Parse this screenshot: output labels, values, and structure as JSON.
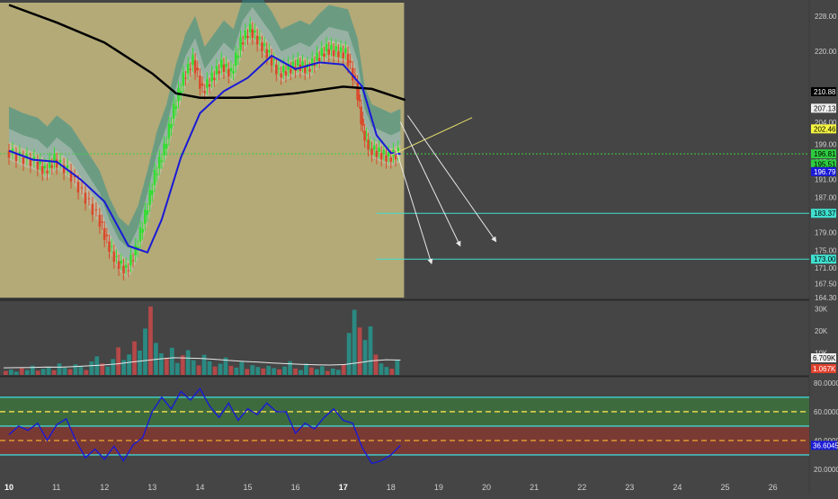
{
  "chart_data": [
    {
      "type": "candlestick",
      "panel": "price",
      "title": "",
      "ylim": [
        164.3,
        231
      ],
      "yticks": [
        164.3,
        167.5,
        171.0,
        175.0,
        179.0,
        183.0,
        187.0,
        191.0,
        195.0,
        199.0,
        204.0,
        210.88,
        220.0,
        228.0
      ],
      "ytick_labels": [
        "164.30",
        "167.50",
        "171.00",
        "175.00",
        "179.00",
        "183.00",
        "187.00",
        "191.00",
        "195.00",
        "199.00",
        "204.00",
        "210.88",
        "220.00",
        "228.00"
      ],
      "price_labels": [
        {
          "value": 210.88,
          "text": "210.88",
          "bg": "#000000",
          "fg": "#ffffff"
        },
        {
          "value": 207.13,
          "text": "207.13",
          "bg": "#f0f0f0",
          "fg": "#000000"
        },
        {
          "value": 202.46,
          "text": "202.46",
          "bg": "#f5f542",
          "fg": "#000000"
        },
        {
          "value": 196.81,
          "text": "196.81",
          "bg": "#2ecc40",
          "fg": "#000000"
        },
        {
          "value": 194.51,
          "text": "195.51",
          "bg": "#2ecc40",
          "fg": "#000000"
        },
        {
          "value": 192.79,
          "text": "196.79",
          "bg": "#1a1ad6",
          "fg": "#ffffff"
        },
        {
          "value": 183.37,
          "text": "183.37",
          "bg": "#40e0d0",
          "fg": "#000000"
        },
        {
          "value": 173.0,
          "text": "173.00",
          "bg": "#40e0d0",
          "fg": "#000000"
        }
      ],
      "current_price_line": 196.81,
      "horizontal_levels": [
        183.37,
        173.0
      ],
      "x_labels": [
        "10",
        "11",
        "12",
        "13",
        "14",
        "15",
        "16",
        "17",
        "18",
        "19",
        "20",
        "21",
        "22",
        "23",
        "24",
        "25",
        "26"
      ],
      "bold_x_labels": [
        "10",
        "17"
      ],
      "close_series": [
        {
          "t": 0.0,
          "v": 197.5
        },
        {
          "t": 0.3,
          "v": 196.0
        },
        {
          "t": 0.6,
          "v": 195.0
        },
        {
          "t": 0.8,
          "v": 193.0
        },
        {
          "t": 1.0,
          "v": 195.5
        },
        {
          "t": 1.3,
          "v": 193.0
        },
        {
          "t": 1.6,
          "v": 188.0
        },
        {
          "t": 1.9,
          "v": 183.0
        },
        {
          "t": 2.1,
          "v": 177.0
        },
        {
          "t": 2.3,
          "v": 172.5
        },
        {
          "t": 2.5,
          "v": 170.5
        },
        {
          "t": 2.7,
          "v": 175.0
        },
        {
          "t": 2.9,
          "v": 183.0
        },
        {
          "t": 3.1,
          "v": 192.0
        },
        {
          "t": 3.3,
          "v": 198.0
        },
        {
          "t": 3.5,
          "v": 207.0
        },
        {
          "t": 3.7,
          "v": 214.0
        },
        {
          "t": 3.9,
          "v": 218.0
        },
        {
          "t": 4.1,
          "v": 211.0
        },
        {
          "t": 4.3,
          "v": 214.0
        },
        {
          "t": 4.5,
          "v": 217.0
        },
        {
          "t": 4.7,
          "v": 215.0
        },
        {
          "t": 4.9,
          "v": 222.0
        },
        {
          "t": 5.1,
          "v": 225.0
        },
        {
          "t": 5.3,
          "v": 222.0
        },
        {
          "t": 5.5,
          "v": 219.0
        },
        {
          "t": 5.7,
          "v": 215.0
        },
        {
          "t": 5.9,
          "v": 216.0
        },
        {
          "t": 6.1,
          "v": 217.0
        },
        {
          "t": 6.3,
          "v": 216.0
        },
        {
          "t": 6.5,
          "v": 218.5
        },
        {
          "t": 6.7,
          "v": 220.5
        },
        {
          "t": 6.9,
          "v": 220.0
        },
        {
          "t": 7.1,
          "v": 219.5
        },
        {
          "t": 7.3,
          "v": 213.0
        },
        {
          "t": 7.45,
          "v": 202.0
        },
        {
          "t": 7.6,
          "v": 198.0
        },
        {
          "t": 7.8,
          "v": 197.0
        },
        {
          "t": 8.0,
          "v": 196.0
        },
        {
          "t": 8.2,
          "v": 197.0
        }
      ],
      "series": [
        {
          "name": "",
          "role": "ma200",
          "color": "#000000",
          "values": [
            {
              "t": 0.0,
              "v": 230.5
            },
            {
              "t": 1.0,
              "v": 226.5
            },
            {
              "t": 2.0,
              "v": 222.0
            },
            {
              "t": 3.0,
              "v": 215.0
            },
            {
              "t": 3.5,
              "v": 210.5
            },
            {
              "t": 4.0,
              "v": 209.5
            },
            {
              "t": 5.0,
              "v": 209.5
            },
            {
              "t": 6.0,
              "v": 210.5
            },
            {
              "t": 7.0,
              "v": 212.0
            },
            {
              "t": 7.6,
              "v": 211.5
            },
            {
              "t": 8.3,
              "v": 209.0
            }
          ]
        },
        {
          "name": "",
          "role": "ema-fast",
          "color": "#1a1ad6",
          "values": [
            {
              "t": 0.0,
              "v": 197.5
            },
            {
              "t": 0.5,
              "v": 195.5
            },
            {
              "t": 1.0,
              "v": 195.0
            },
            {
              "t": 1.5,
              "v": 191.0
            },
            {
              "t": 2.0,
              "v": 186.0
            },
            {
              "t": 2.5,
              "v": 176.0
            },
            {
              "t": 2.9,
              "v": 174.5
            },
            {
              "t": 3.2,
              "v": 182.0
            },
            {
              "t": 3.6,
              "v": 196.0
            },
            {
              "t": 4.0,
              "v": 206.0
            },
            {
              "t": 4.5,
              "v": 211.0
            },
            {
              "t": 5.0,
              "v": 214.0
            },
            {
              "t": 5.5,
              "v": 219.0
            },
            {
              "t": 6.0,
              "v": 216.0
            },
            {
              "t": 6.5,
              "v": 217.5
            },
            {
              "t": 7.0,
              "v": 217.0
            },
            {
              "t": 7.4,
              "v": 212.0
            },
            {
              "t": 7.7,
              "v": 201.0
            },
            {
              "t": 8.0,
              "v": 197.0
            },
            {
              "t": 8.2,
              "v": 196.8
            }
          ]
        }
      ],
      "projection_arrows": [
        {
          "from_t": 8.1,
          "from_v": 198.0,
          "to_t": 8.85,
          "to_v": 172.0
        },
        {
          "from_t": 8.2,
          "from_v": 204.0,
          "to_t": 9.45,
          "to_v": 176.0
        },
        {
          "from_t": 8.35,
          "from_v": 205.5,
          "to_t": 10.2,
          "to_v": 177.0
        }
      ],
      "trendline": {
        "from_t": 8.0,
        "from_v": 196.5,
        "to_t": 9.7,
        "to_v": 205.0,
        "color": "#e8e36a"
      }
    },
    {
      "type": "bar",
      "panel": "volume",
      "yticks": [
        10000,
        20000,
        30000
      ],
      "ytick_labels": [
        "10K",
        "20K",
        "30K"
      ],
      "ylim": [
        0,
        33000
      ],
      "labels": [
        {
          "value": 6709,
          "text": "6.709K",
          "bg": "#f0f0f0",
          "fg": "#000000"
        },
        {
          "value": 1067,
          "text": "1.067K",
          "bg": "#e0402d",
          "fg": "#ffffff"
        }
      ],
      "bar_colors": {
        "up": "#2a8a82",
        "down": "#b54848"
      },
      "values": [
        1800,
        2400,
        1500,
        3100,
        2200,
        4200,
        1900,
        2800,
        3600,
        2100,
        5200,
        3300,
        2600,
        4800,
        3900,
        2200,
        6100,
        8400,
        5200,
        3800,
        7200,
        12500,
        6800,
        9300,
        15200,
        11000,
        21000,
        31000,
        14500,
        9800,
        7600,
        12300,
        5400,
        8900,
        11200,
        6700,
        4300,
        9100,
        6200,
        3800,
        5100,
        7900,
        4100,
        3300,
        5900,
        2700,
        4400,
        3600,
        2900,
        4100,
        3100,
        2500,
        3800,
        6200,
        2900,
        2200,
        5100,
        3400,
        2600,
        3900,
        1800,
        2900,
        2300,
        4700,
        19000,
        29500,
        21500,
        15800,
        22000,
        9200,
        5200,
        3600,
        2800,
        6709
      ],
      "avg_line": [
        3200,
        3300,
        3400,
        3600,
        3500,
        3800,
        4100,
        4500,
        5000,
        5800,
        6500,
        7200,
        7800,
        7600,
        7400,
        7000,
        6500,
        6100,
        5800,
        5400,
        5100,
        4800,
        4600,
        4500,
        4700,
        5500,
        6400,
        6900,
        6709
      ]
    },
    {
      "type": "line",
      "panel": "oscillator",
      "ylim": [
        15,
        83
      ],
      "yticks": [
        20,
        40,
        60,
        80
      ],
      "ytick_labels": [
        "20.0000",
        "40.0000",
        "60.0000",
        "80.0000"
      ],
      "label": {
        "value": 36.6045,
        "text": "36.6045",
        "bg": "#1a1ad6",
        "fg": "#ffffff"
      },
      "bands": [
        {
          "from": 50,
          "to": 70,
          "color": "#3e6b3e"
        },
        {
          "from": 30,
          "to": 50,
          "color": "#7a3a34"
        }
      ],
      "levels": [
        {
          "value": 70,
          "color": "#40d4d4",
          "dash": false
        },
        {
          "value": 60,
          "color": "#e8d84a",
          "dash": true
        },
        {
          "value": 50,
          "color": "#40d4d4",
          "dash": false
        },
        {
          "value": 40,
          "color": "#e8a030",
          "dash": true
        },
        {
          "value": 30,
          "color": "#40d4d4",
          "dash": false
        }
      ],
      "series": [
        {
          "name": "",
          "color": "#1a1ad6",
          "values": [
            {
              "t": 0.0,
              "v": 44
            },
            {
              "t": 0.2,
              "v": 50
            },
            {
              "t": 0.4,
              "v": 47
            },
            {
              "t": 0.6,
              "v": 52
            },
            {
              "t": 0.8,
              "v": 40
            },
            {
              "t": 1.0,
              "v": 51
            },
            {
              "t": 1.2,
              "v": 55
            },
            {
              "t": 1.4,
              "v": 40
            },
            {
              "t": 1.6,
              "v": 28
            },
            {
              "t": 1.8,
              "v": 34
            },
            {
              "t": 2.0,
              "v": 27
            },
            {
              "t": 2.2,
              "v": 36
            },
            {
              "t": 2.4,
              "v": 26
            },
            {
              "t": 2.6,
              "v": 37
            },
            {
              "t": 2.8,
              "v": 42
            },
            {
              "t": 3.0,
              "v": 60
            },
            {
              "t": 3.2,
              "v": 70
            },
            {
              "t": 3.4,
              "v": 62
            },
            {
              "t": 3.6,
              "v": 74
            },
            {
              "t": 3.8,
              "v": 68
            },
            {
              "t": 4.0,
              "v": 76
            },
            {
              "t": 4.2,
              "v": 64
            },
            {
              "t": 4.4,
              "v": 56
            },
            {
              "t": 4.6,
              "v": 66
            },
            {
              "t": 4.8,
              "v": 54
            },
            {
              "t": 5.0,
              "v": 62
            },
            {
              "t": 5.2,
              "v": 58
            },
            {
              "t": 5.4,
              "v": 66
            },
            {
              "t": 5.6,
              "v": 60
            },
            {
              "t": 5.8,
              "v": 60
            },
            {
              "t": 6.0,
              "v": 45
            },
            {
              "t": 6.2,
              "v": 52
            },
            {
              "t": 6.4,
              "v": 48
            },
            {
              "t": 6.6,
              "v": 56
            },
            {
              "t": 6.8,
              "v": 62
            },
            {
              "t": 7.0,
              "v": 54
            },
            {
              "t": 7.2,
              "v": 52
            },
            {
              "t": 7.4,
              "v": 35
            },
            {
              "t": 7.6,
              "v": 24
            },
            {
              "t": 7.8,
              "v": 26
            },
            {
              "t": 8.0,
              "v": 30
            },
            {
              "t": 8.2,
              "v": 36.6
            }
          ]
        }
      ]
    }
  ]
}
